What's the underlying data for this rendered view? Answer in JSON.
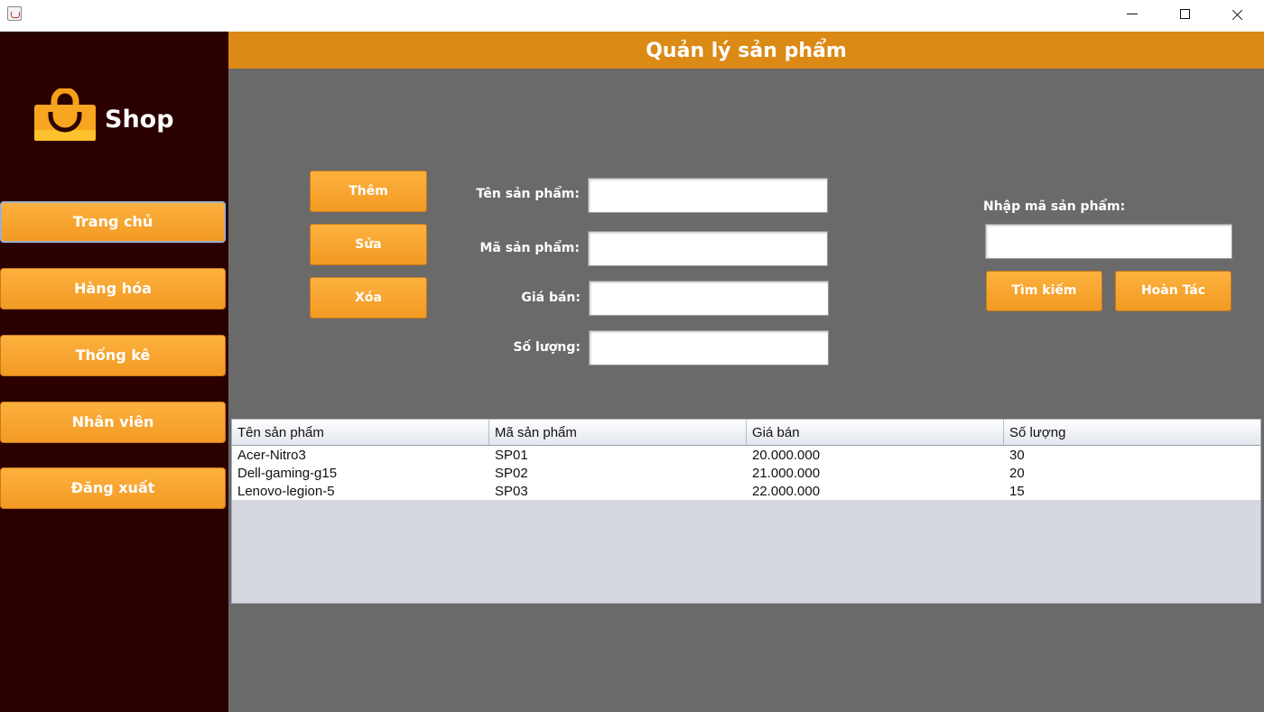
{
  "window": {
    "icon": "java-cup-icon"
  },
  "sidebar": {
    "logo_text": "Shop",
    "logo_icon": "shopping-bag-icon",
    "items": [
      {
        "label": "Trang chủ"
      },
      {
        "label": "Hàng hóa"
      },
      {
        "label": "Thống kê"
      },
      {
        "label": "Nhân viên"
      },
      {
        "label": "Đăng xuất"
      }
    ]
  },
  "header": {
    "title": "Quản lý sản phẩm"
  },
  "actions": {
    "add": "Thêm",
    "edit": "Sửa",
    "delete": "Xóa"
  },
  "form": {
    "name_label": "Tên sản phẩm:",
    "name_value": "",
    "code_label": "Mã sản phẩm:",
    "code_value": "",
    "price_label": "Giá bán:",
    "price_value": "",
    "qty_label": "Số lượng:",
    "qty_value": ""
  },
  "search": {
    "label": "Nhập mã sản phẩm:",
    "value": "",
    "search_button": "Tìm kiếm",
    "undo_button": "Hoàn Tác"
  },
  "table": {
    "columns": [
      "Tên sản phẩm",
      "Mã sản phẩm",
      "Giá bán",
      "Số lượng"
    ],
    "rows": [
      [
        "Acer-Nitro3",
        "SP01",
        "20.000.000",
        "30"
      ],
      [
        "Dell-gaming-g15",
        "SP02",
        "21.000.000",
        "20"
      ],
      [
        "Lenovo-legion-5",
        "SP03",
        "22.000.000",
        "15"
      ]
    ]
  },
  "colors": {
    "sidebar_bg": "#2b0000",
    "header_bg": "#db8a16",
    "button_orange": "#f9a630",
    "content_bg": "#6a6a6a"
  }
}
